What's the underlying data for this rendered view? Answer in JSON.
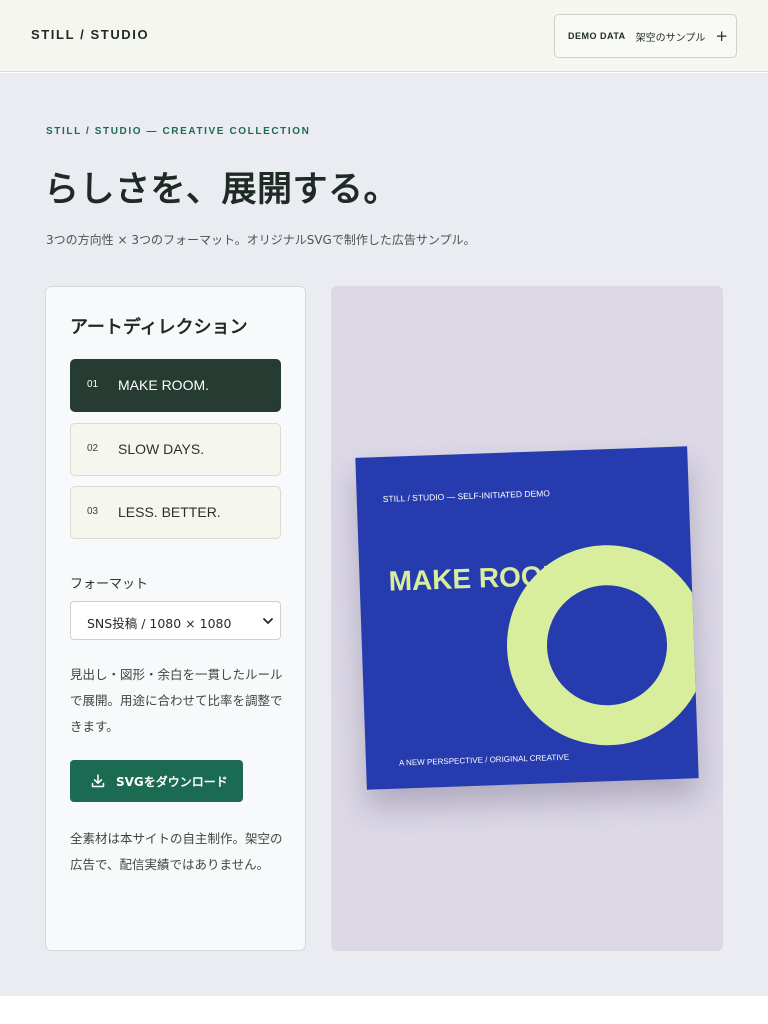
{
  "header": {
    "brand": "STILL / STUDIO",
    "demo_tag": "DEMO DATA",
    "demo_text": "架空のサンプル",
    "demo_plus": "+"
  },
  "hero": {
    "eyebrow": "STILL / STUDIO — CREATIVE COLLECTION",
    "headline": "らしさを、展開する。",
    "subline": "3つの方向性 × 3つのフォーマット。オリジナルSVGで制作した広告サンプル。"
  },
  "panel": {
    "title": "アートディレクション",
    "directions": [
      {
        "num": "01",
        "label": "MAKE ROOM.",
        "active": true
      },
      {
        "num": "02",
        "label": "SLOW DAYS.",
        "active": false
      },
      {
        "num": "03",
        "label": "LESS. BETTER.",
        "active": false
      }
    ],
    "format_label": "フォーマット",
    "format_value": "SNS投稿 / 1080 × 1080",
    "description": "見出し・図形・余白を一貫したルールで展開。用途に合わせて比率を調整できます。",
    "download_label": "SVGをダウンロード",
    "note": "全素材は本サイトの自主制作。架空の広告で、配信実績ではありません。"
  },
  "poster": {
    "top_text": "STILL / STUDIO — SELF-INITIATED DEMO",
    "headline": "MAKE ROOM.",
    "bottom_text": "A NEW PERSPECTIVE / ORIGINAL CREATIVE",
    "bg_color": "#263cae",
    "accent_color": "#d8ee9c"
  },
  "colors": {
    "primary": "#1b6a52",
    "active_item": "#263b31",
    "page_bg": "#ebebf2"
  }
}
